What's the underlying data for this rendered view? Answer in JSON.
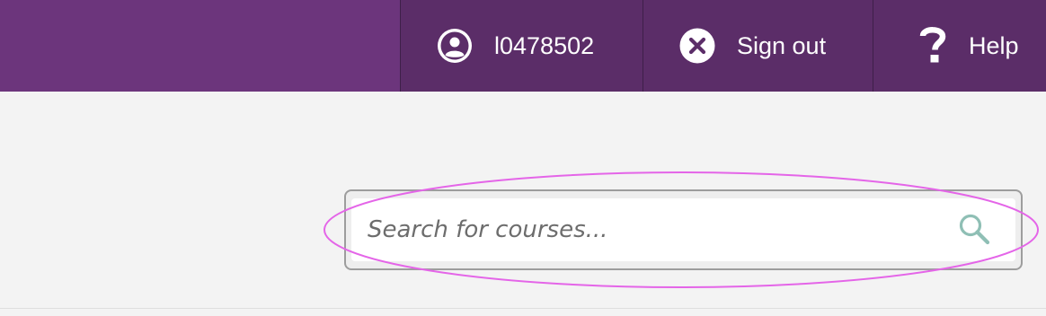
{
  "header": {
    "brand_color": "#6c357c",
    "nav_color": "#5b2d68",
    "user": {
      "icon": "user-circle-icon",
      "label": "l0478502"
    },
    "sign_out": {
      "icon": "close-circle-icon",
      "label": "Sign out"
    },
    "help": {
      "icon": "question-mark-icon",
      "label": "Help"
    }
  },
  "search": {
    "placeholder": "Search for courses...",
    "value": "",
    "icon": "search-icon",
    "icon_color": "#8fbfb5"
  },
  "annotation": {
    "type": "highlight-ellipse",
    "color": "#e465e8"
  }
}
